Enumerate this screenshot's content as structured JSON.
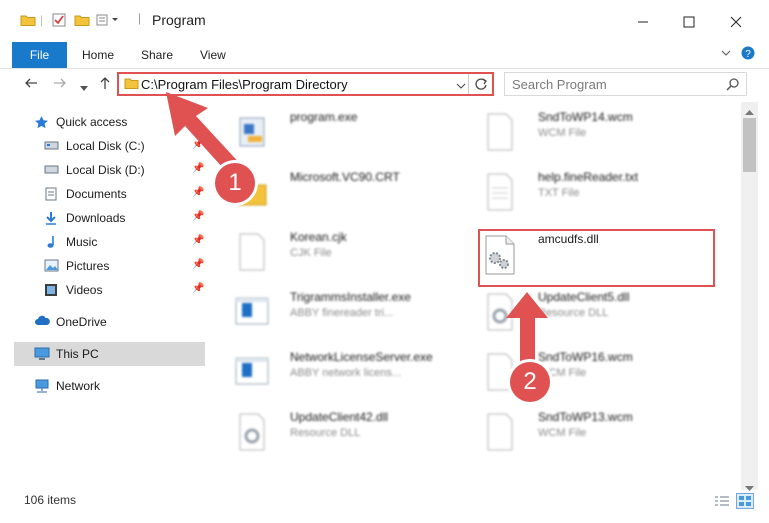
{
  "window": {
    "title": "Program"
  },
  "ribbon": {
    "tabs": [
      "File",
      "Home",
      "Share",
      "View"
    ]
  },
  "address": {
    "path": "C:\\Program Files\\Program Directory"
  },
  "search": {
    "placeholder": "Search Program"
  },
  "nav": {
    "items": [
      {
        "label": "Quick access",
        "icon": "star-icon",
        "pinned": false
      },
      {
        "label": "Local Disk (C:)",
        "icon": "drive-icon",
        "pinned": true
      },
      {
        "label": "Local Disk (D:)",
        "icon": "drive-icon",
        "pinned": true
      },
      {
        "label": "Documents",
        "icon": "documents-icon",
        "pinned": true
      },
      {
        "label": "Downloads",
        "icon": "download-icon",
        "pinned": true
      },
      {
        "label": "Music",
        "icon": "music-icon",
        "pinned": true
      },
      {
        "label": "Pictures",
        "icon": "pictures-icon",
        "pinned": true
      },
      {
        "label": "Videos",
        "icon": "videos-icon",
        "pinned": true
      },
      {
        "label": "OneDrive",
        "icon": "cloud-icon",
        "pinned": false
      },
      {
        "label": "This PC",
        "icon": "computer-icon",
        "pinned": false,
        "selected": true
      },
      {
        "label": "Network",
        "icon": "network-icon",
        "pinned": false
      }
    ]
  },
  "files": {
    "left": [
      {
        "name": "program.exe",
        "type": ""
      },
      {
        "name": "Microsoft.VC90.CRT",
        "type": ""
      },
      {
        "name": "Korean.cjk",
        "type": "CJK File"
      },
      {
        "name": "TrigrammsInstaller.exe",
        "type": "ABBY finereader tri..."
      },
      {
        "name": "NetworkLicenseServer.exe",
        "type": "ABBY network licens..."
      },
      {
        "name": "UpdateClient42.dll",
        "type": "Resource DLL"
      }
    ],
    "right": [
      {
        "name": "SndToWP14.wcm",
        "type": "WCM File"
      },
      {
        "name": "help.fineReader.txt",
        "type": "TXT File"
      },
      {
        "name": "amcudfs.dll",
        "type": ""
      },
      {
        "name": "UpdateClient5.dll",
        "type": "Resource DLL"
      },
      {
        "name": "SndToWP16.wcm",
        "type": "WCM File"
      },
      {
        "name": "SndToWP13.wcm",
        "type": "WCM File"
      }
    ]
  },
  "status": {
    "count": "106 items"
  },
  "annotations": {
    "step1": "1",
    "step2": "2",
    "color": "#e05252"
  }
}
